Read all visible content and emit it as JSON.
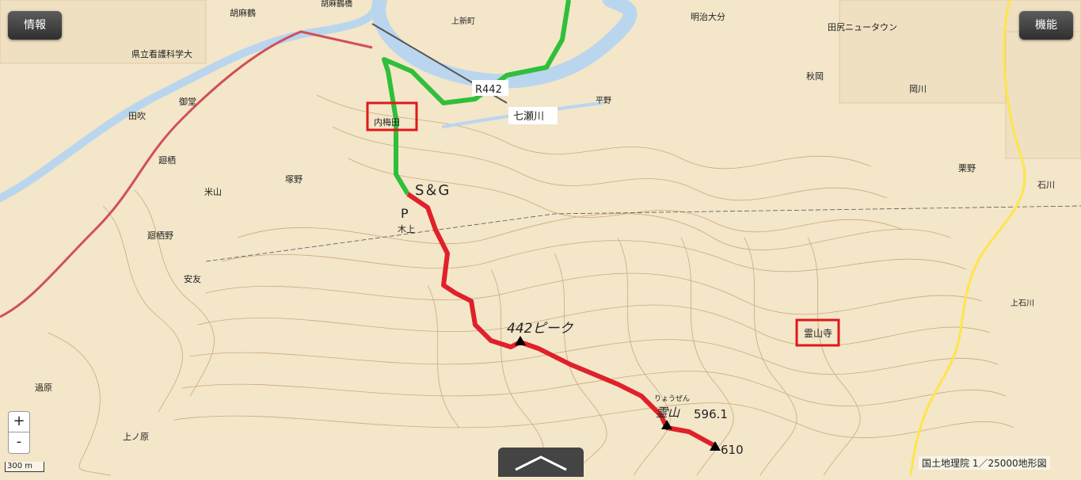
{
  "controls": {
    "info_label": "情報",
    "func_label": "機能",
    "zoom_in": "+",
    "zoom_out": "-",
    "scale": "300 m",
    "attribution": "国土地理院 1／25000地形図"
  },
  "colors": {
    "terrain": "#f3e6c9",
    "contour": "#c9a373",
    "route_red": "#e0202a",
    "route_green": "#2fbf3a",
    "river": "#b9d6ee",
    "road_red": "#d0505a",
    "road_yellow": "#ffe54a",
    "label_box": "#e01818"
  },
  "annotations": {
    "start_goal": "S＆G",
    "parking": "P",
    "peak_label": "442ピーク",
    "summit_elev": "596.1",
    "peak_610": "610",
    "route_label": "R442",
    "river_label": "七瀬川"
  },
  "boxed_places": {
    "uchinowata": "内梅田",
    "reizanji": "霊山寺"
  },
  "places": {
    "lbl_hospital": "県立看護科学大",
    "lbl_koma": "胡麻鶴",
    "lbl_kamishin": "上新町",
    "lbl_meiji": "明治大分",
    "lbl_danchi": "田尻ニュータウン",
    "lbl_mitsu": "御堂",
    "lbl_tabuki": "田吹",
    "lbl_sasuisu": "廻栖",
    "lbl_sasuisuno": "廻栖野",
    "lbl_komeyama": "米山",
    "lbl_tsukano": "塚野",
    "lbl_kijo": "木上",
    "lbl_anyu": "安友",
    "lbl_kabara": "過原",
    "lbl_kamihara": "上ノ原",
    "lbl_hirano": "平野",
    "lbl_akioka": "秋岡",
    "lbl_okagawa": "岡川",
    "lbl_kurino": "栗野",
    "lbl_ishikawa": "石川",
    "lbl_kamiishikawa": "上石川",
    "lbl_reizan_kana": "りょうぜん",
    "lbl_reizan": "霊山",
    "lbl_bridge": "胡麻鶴橋"
  }
}
